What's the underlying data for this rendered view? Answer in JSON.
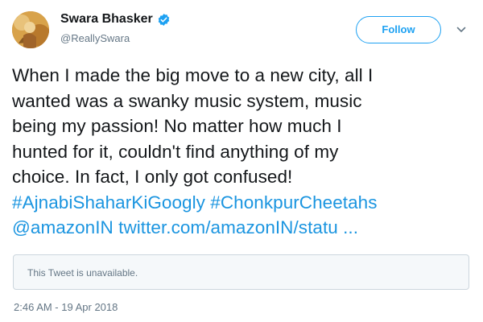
{
  "author": {
    "name": "Swara Bhasker",
    "handle": "@ReallySwara",
    "verified": true
  },
  "follow_button": {
    "label": "Follow"
  },
  "tweet": {
    "lines": [
      "When I made the big move to a new city, all I",
      "wanted was a swanky music system, music",
      "being my passion! No matter how much I",
      "hunted for it, couldn't find anything of my",
      "choice. In fact, I only got confused!"
    ],
    "hashtags": [
      "#AjnabiShaharKiGoogly",
      "#ChonkpurCheetahs"
    ],
    "mention": "@amazonIN",
    "link": "twitter.com/amazonIN/statu ..."
  },
  "quoted_tweet": {
    "text": "This Tweet is unavailable."
  },
  "timestamp": "2:46 AM - 19 Apr 2018",
  "colors": {
    "link": "#1b95e0",
    "follow_border": "#1da1f2",
    "secondary_text": "#657786",
    "verified_badge": "#1da1f2"
  },
  "icons": {
    "verified": "verified-badge-icon",
    "caret": "chevron-down-icon"
  }
}
